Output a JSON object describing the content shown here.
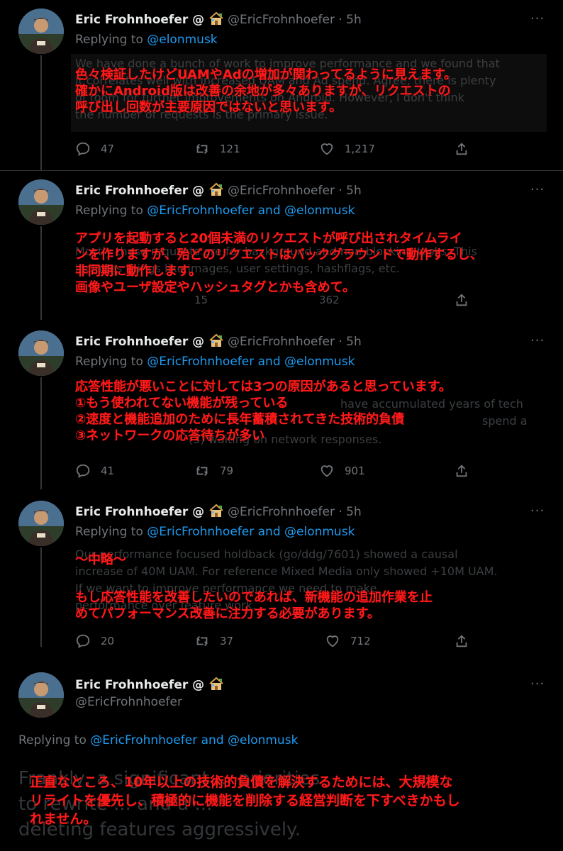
{
  "tweets": [
    {
      "name": "Eric Frohnhoefer @",
      "handle": "@EricFrohnhoefer · 5h",
      "reply_prefix": "Replying to",
      "reply_targets": "@elonmusk",
      "ghost_lines": [
        "We have done a bunch of work to improve performance and we found that",
        "it correlates well with increased UAM and Ad spend. Agree, there is plenty",
        "of room for further improvements on Android. However, I don't think",
        "the number of requests is the primary issue."
      ],
      "overlay_lines": [
        "色々検証したけどUAMやAdの増加が関わってるように見えます。",
        "確かにAndroid版は改善の余地が多々ありますが、リクエストの",
        "呼び出し回数が主要原因ではないと思います。"
      ],
      "metrics": {
        "replies": "47",
        "retweets": "121",
        "likes": "1,217"
      }
    },
    {
      "name": "Eric Frohnhoefer @",
      "handle": "@EricFrohnhoefer · 5h",
      "reply_prefix": "Replying to",
      "reply_targets": "@EricFrohnhoefer and @elonmusk",
      "ghost_lines": [
        "Mostly these requests are for background and non-blocking tasks. This",
        "includes things like images, user settings, hashflags, etc."
      ],
      "overlay_lines": [
        "アプリを起動すると20個未満のリクエストが呼び出されタイムライ",
        "ンを作りますが、殆どのリクエストはバックグラウンドで動作するし、",
        "非同期に動作します。",
        "画像やユーザ設定やハッシュタグとかも含めて。"
      ],
      "metrics": {
        "replies": "",
        "retweets": "15",
        "likes": "362"
      }
    },
    {
      "name": "Eric Frohnhoefer @",
      "handle": "@EricFrohnhoefer · 5h",
      "reply_prefix": "Replying to",
      "reply_targets": "@EricFrohnhoefer and @elonmusk",
      "ghost_lines": [
        "have accumulated years of tech",
        "spend a",
        "(3) waiting on network responses."
      ],
      "overlay_lines": [
        "応答性能が悪いことに対しては3つの原因があると思っています。",
        "①もう使われてない機能が残っている",
        "②速度と機能追加のために長年蓄積されてきた技術的負債",
        "③ネットワークの応答待ちが多い"
      ],
      "metrics": {
        "replies": "41",
        "retweets": "79",
        "likes": "901"
      }
    },
    {
      "name": "Eric Frohnhoefer @",
      "handle": "@EricFrohnhoefer · 5h",
      "reply_prefix": "Replying to",
      "reply_targets": "@EricFrohnhoefer and @elonmusk",
      "ghost_lines": [
        "Our performance focused holdback (go/ddg/7601) showed a causal",
        "increase of 40M UAM. For reference Mixed Media only showed +10M UAM.",
        "If we want to improve performance we need to make",
        "performance over feature work."
      ],
      "overlay_lines": [
        "〜中略〜",
        "もし応答性能を改善したいのであれば、新機能の追加作業を止",
        "めてパフォーマンス改善に注力する必要があります。"
      ],
      "metrics": {
        "replies": "20",
        "retweets": "37",
        "likes": "712"
      }
    },
    {
      "name": "Eric Frohnhoefer @",
      "handle": "@EricFrohnhoefer",
      "reply_prefix": "Replying to",
      "reply_targets": "@EricFrohnhoefer and @elonmusk",
      "ghost_lines": [
        "Frankly, a significant ... priorities",
        "to rewrite ... and a ...",
        "deleting features aggressively."
      ],
      "overlay_lines": [
        "正直なところ、10年以上の技術的負債を解決するためには、大規模な",
        "リライトを優先し、積極的に機能を削除する経営判断を下すべきかもし",
        "れません。"
      ]
    }
  ]
}
